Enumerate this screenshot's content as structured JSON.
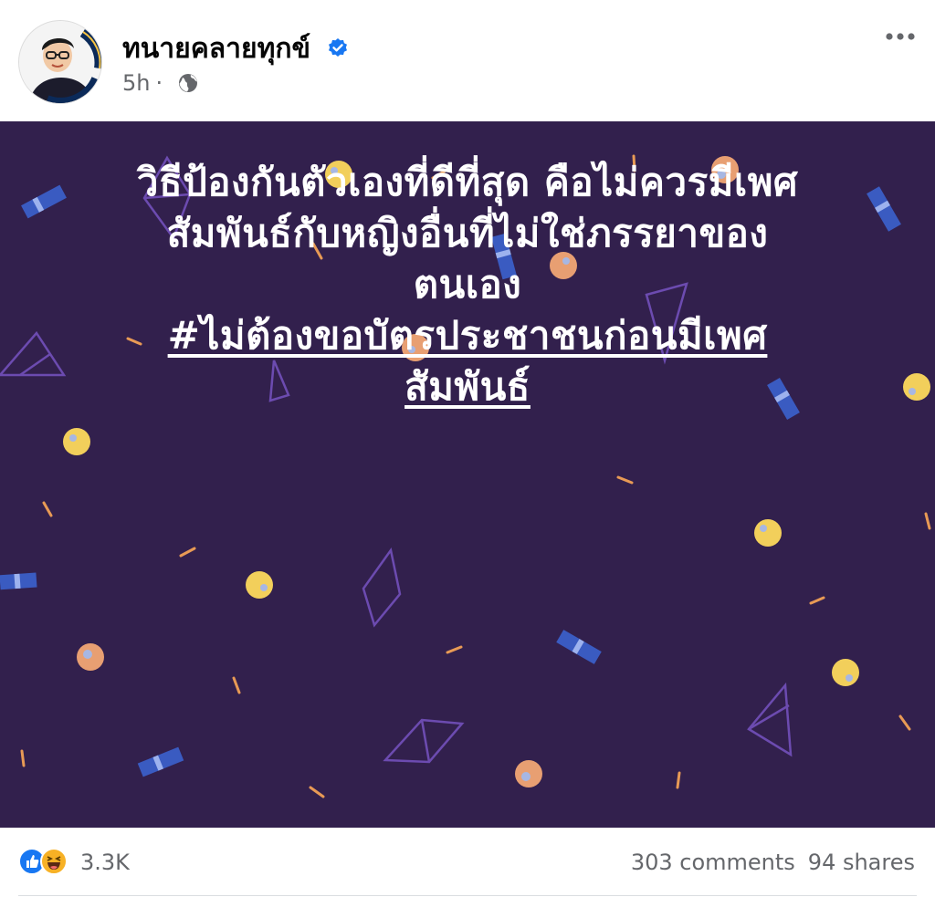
{
  "post": {
    "author": "ทนายคลายทุกข์",
    "avatar_caption": "ทนายคลายทุกข์",
    "time": "5h",
    "separator": "·",
    "verified_icon": "verified-badge-icon",
    "privacy_icon": "globe-icon",
    "more_icon": "more-options-icon",
    "text_line1": "วิธีป้องกันตัวเองที่ดีที่สุด คือไม่ควรมีเพศ",
    "text_line2": "สัมพันธ์กับหญิงอื่นที่ไม่ใช่ภรรยาของ",
    "text_line3": "ตนเอง",
    "hashtag_line1": "#ไม่ต้องขอบัตรประชาชนก่อนมีเพศ",
    "hashtag_line2": "สัมพันธ์",
    "background_color": "#32204d"
  },
  "footer": {
    "reaction_icons": [
      "like-icon",
      "haha-icon"
    ],
    "reaction_count": "3.3K",
    "comments": "303 comments",
    "shares": "94 shares"
  },
  "colors": {
    "accent": "#1877f2",
    "secondary_text": "#65676b",
    "post_text": "#ffffff"
  }
}
